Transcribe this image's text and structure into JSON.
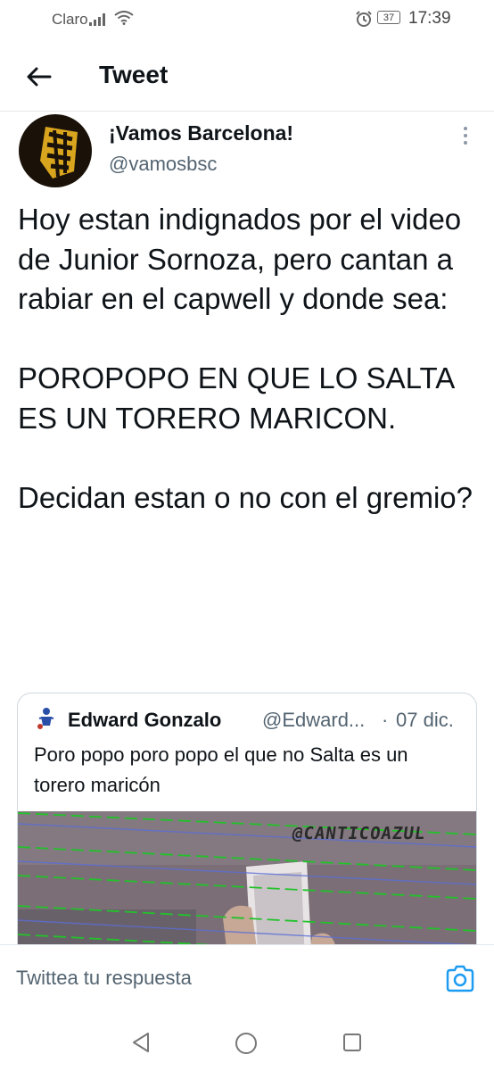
{
  "status_bar": {
    "carrier": "Claro",
    "battery": "37",
    "time": "17:39",
    "icons": [
      "signal-icon",
      "wifi-icon",
      "alarm-icon",
      "battery-icon"
    ]
  },
  "header": {
    "title": "Tweet",
    "back_icon": "arrow-left-icon"
  },
  "tweet": {
    "author_name": "¡Vamos Barcelona!",
    "author_handle": "@vamosbsc",
    "text": "Hoy estan indignados por el video de Junior Sornoza, pero cantan a rabiar en el capwell y donde sea:\n\nPOROPOPO EN QUE LO SALTA ES UN TORERO MARICON.\n\nDecidan estan o no con el gremio?"
  },
  "quoted_tweet": {
    "author_name": "Edward Gonzalo",
    "author_handle": "@Edward...",
    "separator": "·",
    "date": "07 dic.",
    "text": "Poro popo poro popo el que no Salta es un torero maricón",
    "media_watermark": "@CANTICOAZUL"
  },
  "reply": {
    "placeholder": "Twittea tu respuesta",
    "camera_icon": "camera-icon"
  },
  "colors": {
    "accent": "#1d9bf0",
    "text": "#0f1419",
    "secondary": "#536471",
    "border": "#cfd9de"
  }
}
